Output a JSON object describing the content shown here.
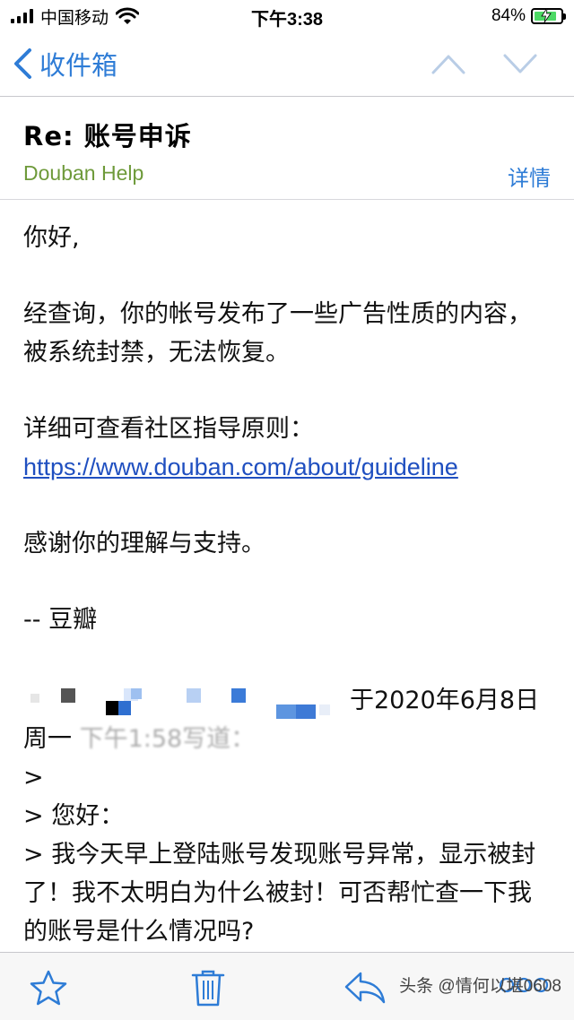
{
  "status_bar": {
    "carrier": "中国移动",
    "time": "下午3:38",
    "battery_percent": "84%",
    "battery_level": 0.84
  },
  "nav": {
    "back_label": "收件箱"
  },
  "header": {
    "subject": "Re: 账号申诉",
    "sender": "Douban Help",
    "details_label": "详情"
  },
  "body": {
    "greeting": "你好,",
    "paragraph_1": "经查询，你的帐号发布了一些广告性质的内容，被系统封禁，无法恢复。",
    "paragraph_2_prefix": "详细可查看社区指导原则：",
    "guideline_url": "https://www.douban.com/about/guideline",
    "paragraph_3": "感谢你的理解与支持。",
    "signature": "-- 豆瓣"
  },
  "quote": {
    "date_text": "于2020年6月8日",
    "weekday": "周一",
    "time_obscured": "下午1:58写道：",
    "line_1": ">",
    "line_2": "> 您好：",
    "line_3": "> 我今天早上登陆账号发现账号异常，显示被封了！我不太明白为什么被封！可否帮忙查一下我的账号是什么情况吗?"
  },
  "toolbar": {
    "watermark": "头条 @情何以堪0608"
  },
  "colors": {
    "accent": "#2e7cd6",
    "sender": "#6e9a3a",
    "link": "#1f4fc0",
    "battery": "#4cd964"
  },
  "icons": [
    "wifi-icon",
    "battery-icon",
    "back-chevron-icon",
    "up-arrow-icon",
    "down-arrow-icon",
    "star-icon",
    "trash-icon",
    "reply-icon",
    "more-icon"
  ]
}
